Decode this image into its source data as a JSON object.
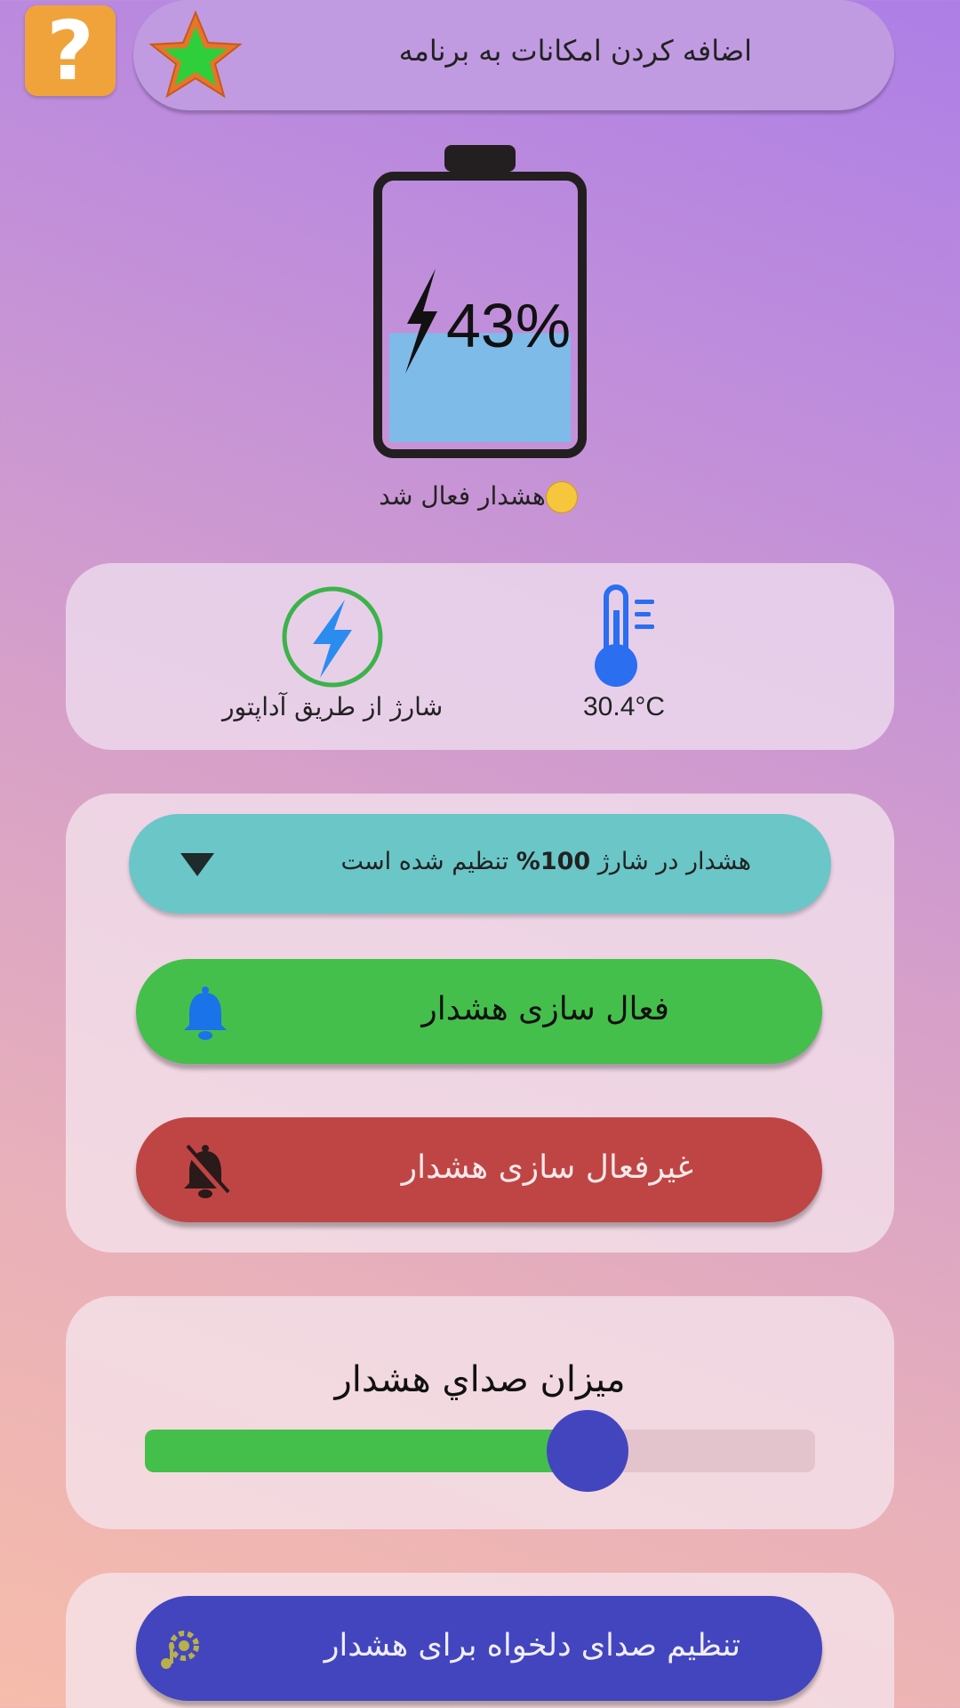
{
  "header": {
    "help_label": "?",
    "add_features_label": "اضافه کردن امکانات به برنامه"
  },
  "battery": {
    "percent_text": "43%",
    "level": 0.43,
    "status_text": "هشدار فعال شد"
  },
  "info": {
    "charge_source_label": "شارژ از طریق آداپتور",
    "temperature_label": "30.4°C"
  },
  "alarm": {
    "select_prefix": "هشدار در شارژ",
    "select_value": "100%",
    "select_suffix": "تنظیم شده است",
    "activate_label": "فعال سازی هشدار",
    "deactivate_label": "غیرفعال سازی هشدار"
  },
  "volume": {
    "title": "ميزان صداي هشدار",
    "level": 0.66
  },
  "custom_sound": {
    "label": "تنظیم صدای دلخواه برای هشدار"
  },
  "colors": {
    "accent_green": "#45bf4b",
    "accent_red": "#bf4544",
    "accent_blue": "#4345bf",
    "accent_teal": "#6bc6c8",
    "battery_fill": "#7ebbe9"
  },
  "icons": {
    "help": "question-mark-icon",
    "star": "star-icon",
    "charge": "lightning-bolt-icon",
    "thermometer": "thermometer-icon",
    "dropdown": "chevron-down-icon",
    "bell": "bell-icon",
    "bell_off": "bell-off-icon",
    "music_gear": "music-settings-icon"
  }
}
